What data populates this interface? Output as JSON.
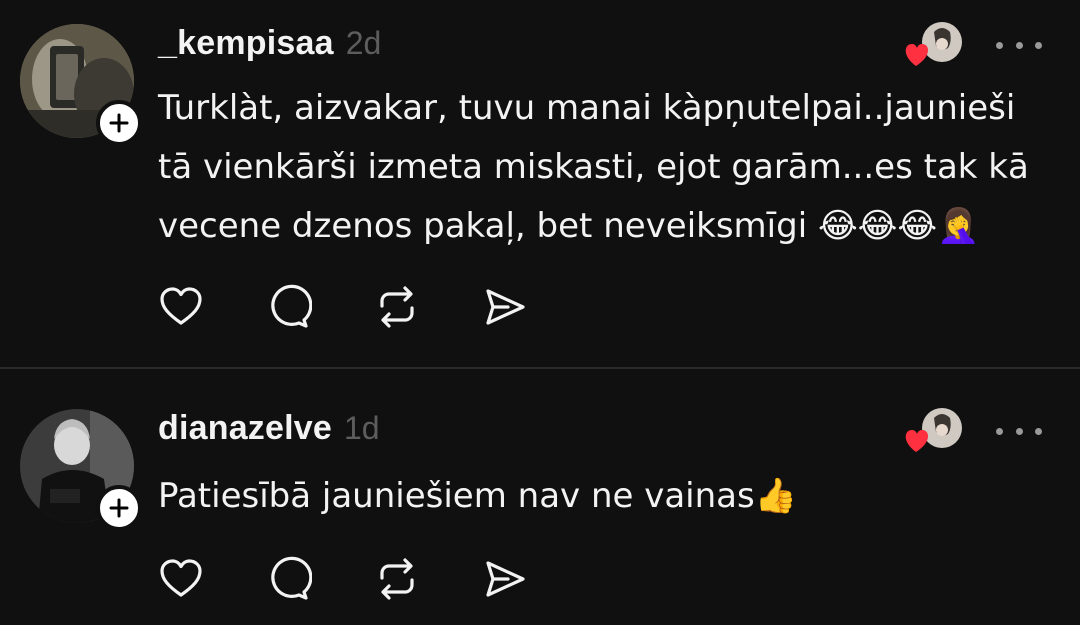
{
  "posts": [
    {
      "username": "_kempisaa",
      "time": "2d",
      "text": "Turklàt, aizvakar, tuvu manai kàpņutelpai..jaunieši tā vienkārši izmeta miskasti, ejot garām...es tak kā vecene dzenos pakaļ, bet neveiksmīgi 😂😂😂🤦‍♀️",
      "avatar_icon": "profile-photo-icon",
      "liked_by_icon": "liked-by-author-icon"
    },
    {
      "username": "dianazelve",
      "time": "1d",
      "text": "Patiesībā jauniešiem nav ne vainas👍",
      "avatar_icon": "profile-photo-icon",
      "liked_by_icon": "liked-by-author-icon"
    }
  ],
  "actions": [
    "like-icon",
    "reply-icon",
    "repost-icon",
    "share-icon"
  ],
  "colors": {
    "background": "#101010",
    "text": "#f3f3f3",
    "muted": "#5d5d5d",
    "heart": "#ff3040",
    "divider": "#2b2b2b"
  }
}
